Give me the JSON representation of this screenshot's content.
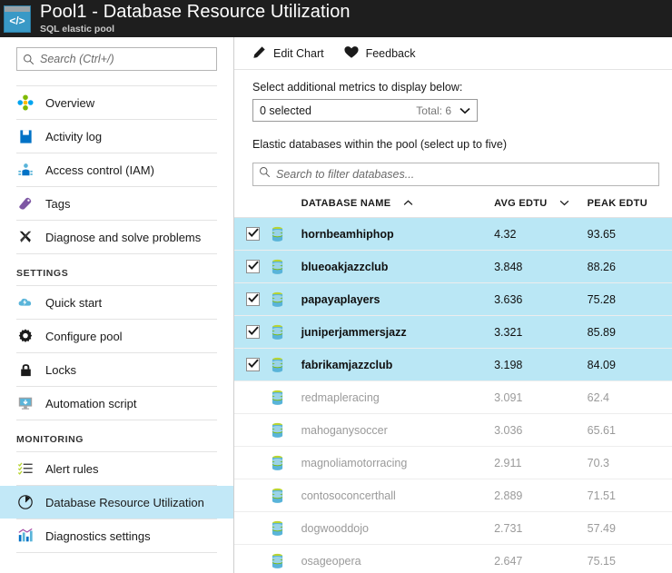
{
  "header": {
    "icon": "code-window-icon",
    "icon_glyph": "</>",
    "title": "Pool1 - Database Resource Utilization",
    "subtitle": "SQL elastic pool"
  },
  "sidebar": {
    "search": {
      "placeholder": "Search (Ctrl+/)",
      "icon": "search-icon"
    },
    "items": [
      {
        "label": "Overview",
        "icon": "overview-diamond-icon",
        "selected": false,
        "type": "item"
      },
      {
        "label": "Activity log",
        "icon": "activity-log-book-icon",
        "selected": false,
        "type": "item"
      },
      {
        "label": "Access control (IAM)",
        "icon": "access-control-people-icon",
        "selected": false,
        "type": "item"
      },
      {
        "label": "Tags",
        "icon": "tag-icon",
        "selected": false,
        "type": "item"
      },
      {
        "label": "Diagnose and solve problems",
        "icon": "wrench-screwdriver-icon",
        "selected": false,
        "type": "item"
      },
      {
        "label": "SETTINGS",
        "type": "group"
      },
      {
        "label": "Quick start",
        "icon": "cloud-bolt-icon",
        "selected": false,
        "type": "item"
      },
      {
        "label": "Configure pool",
        "icon": "gear-icon",
        "selected": false,
        "type": "item"
      },
      {
        "label": "Locks",
        "icon": "lock-icon",
        "selected": false,
        "type": "item"
      },
      {
        "label": "Automation script",
        "icon": "automation-monitor-icon",
        "selected": false,
        "type": "item"
      },
      {
        "label": "MONITORING",
        "type": "group"
      },
      {
        "label": "Alert rules",
        "icon": "checklist-icon",
        "selected": false,
        "type": "item"
      },
      {
        "label": "Database Resource Utilization",
        "icon": "pie-chart-icon",
        "selected": true,
        "type": "item"
      },
      {
        "label": "Diagnostics settings",
        "icon": "bar-chart-icon",
        "selected": false,
        "type": "item"
      }
    ]
  },
  "main": {
    "toolbar": [
      {
        "label": "Edit Chart",
        "icon": "pencil-icon"
      },
      {
        "label": "Feedback",
        "icon": "heart-icon"
      }
    ],
    "metrics_label": "Select additional metrics to display below:",
    "metrics_dropdown": {
      "value": "0 selected",
      "total": "Total: 6",
      "icon": "chevron-down-icon"
    },
    "databases_label": "Elastic databases within the pool (select up to five)",
    "filter": {
      "placeholder": "Search to filter databases...",
      "icon": "search-icon"
    },
    "table": {
      "columns": [
        {
          "label": "DATABASE NAME",
          "sort_icon": "chevron-up-icon"
        },
        {
          "label": "AVG EDTU",
          "sort_icon": "chevron-down-icon"
        },
        {
          "label": "PEAK EDTU",
          "sort_icon": ""
        }
      ],
      "rows": [
        {
          "checked": true,
          "name": "hornbeamhiphop",
          "avg": "4.32",
          "peak": "93.65"
        },
        {
          "checked": true,
          "name": "blueoakjazzclub",
          "avg": "3.848",
          "peak": "88.26"
        },
        {
          "checked": true,
          "name": "papayaplayers",
          "avg": "3.636",
          "peak": "75.28"
        },
        {
          "checked": true,
          "name": "juniperjammersjazz",
          "avg": "3.321",
          "peak": "85.89"
        },
        {
          "checked": true,
          "name": "fabrikamjazzclub",
          "avg": "3.198",
          "peak": "84.09"
        },
        {
          "checked": false,
          "name": "redmapleracing",
          "avg": "3.091",
          "peak": "62.4"
        },
        {
          "checked": false,
          "name": "mahoganysoccer",
          "avg": "3.036",
          "peak": "65.61"
        },
        {
          "checked": false,
          "name": "magnoliamotorracing",
          "avg": "2.911",
          "peak": "70.3"
        },
        {
          "checked": false,
          "name": "contosoconcerthall",
          "avg": "2.889",
          "peak": "71.51"
        },
        {
          "checked": false,
          "name": "dogwooddojo",
          "avg": "2.731",
          "peak": "57.49"
        },
        {
          "checked": false,
          "name": "osageopera",
          "avg": "2.647",
          "peak": "75.15"
        }
      ]
    }
  },
  "colors": {
    "header_bg": "#1e1e1e",
    "accent_blue": "#3999c6",
    "selection_blue": "#bae7f5",
    "nav_selection": "#c2e8f7",
    "muted_text": "#9a9a9a"
  }
}
